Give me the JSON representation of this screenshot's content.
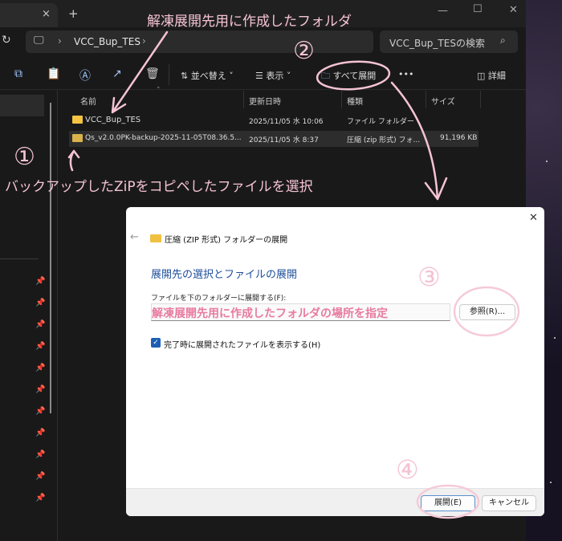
{
  "explorer": {
    "tab_close": "×",
    "new_tab": "+",
    "window_controls": {
      "minimize": "—",
      "maximize": "☐",
      "close": "✕"
    },
    "address": {
      "crumb": "VCC_Bup_TES",
      "separator": "›"
    },
    "search_placeholder": "VCC_Bup_TESの検索",
    "toolbar": {
      "sort": "並べ替え",
      "view": "表示",
      "extract_all": "すべて展開",
      "more": "•••",
      "details": "詳細"
    },
    "columns": [
      "名前",
      "更新日時",
      "種類",
      "サイズ"
    ],
    "rows": [
      {
        "name": "VCC_Bup_TES",
        "date": "2025/11/05 水 10:06",
        "type": "ファイル フォルダー",
        "size": ""
      },
      {
        "name": "Qs_v2.0.0PK-backup-2025-11-05T08.36.5...",
        "date": "2025/11/05 水 8:37",
        "type": "圧縮 (zip 形式) フォ...",
        "size": "91,196 KB"
      }
    ]
  },
  "dialog": {
    "title": "圧縮 (ZIP 形式) フォルダーの展開",
    "heading": "展開先の選択とファイルの展開",
    "field_label": "ファイルを下のフォルダーに展開する(F):",
    "browse": "参照(R)...",
    "checkbox_label": "完了時に展開されたファイルを表示する(H)",
    "checkbox_checked": true,
    "extract": "展開(E)",
    "cancel": "キャンセル",
    "close": "✕",
    "back": "←"
  },
  "annotations": {
    "top": "解凍展開先用に作成したフォルダ",
    "step1": "①",
    "step2": "②",
    "step3": "③",
    "step4": "④",
    "select_zip": "バックアップしたZiPをコピペしたファイルを選択",
    "field_note": "解凍展開先用に作成したフォルダの場所を指定",
    "color": "#f5c3d3"
  }
}
